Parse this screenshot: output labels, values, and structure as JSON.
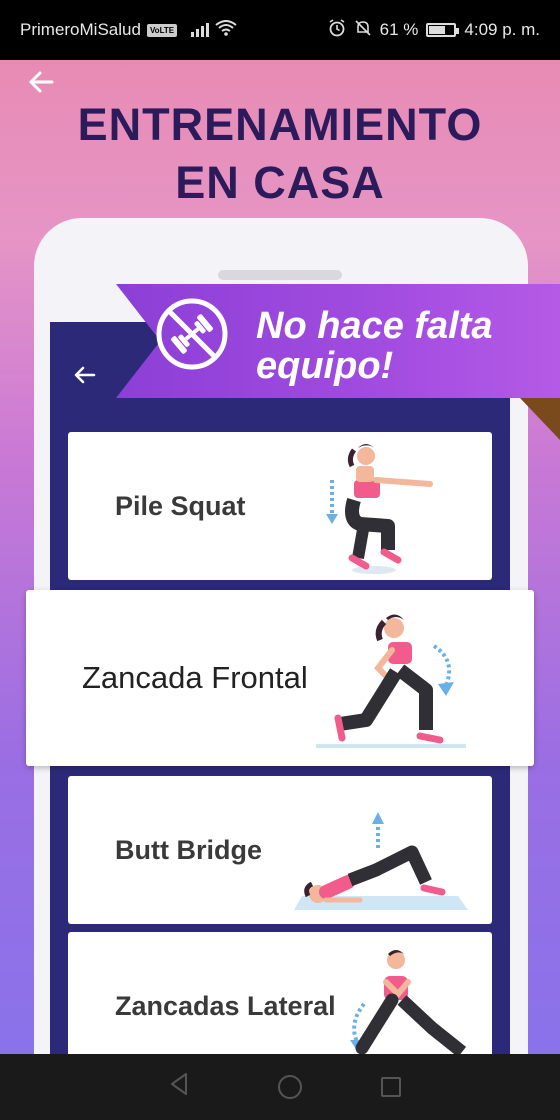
{
  "status_bar": {
    "carrier": "PrimeroMiSalud",
    "volte": "VoLTE",
    "battery": "61 %",
    "battery_level": 0.61,
    "time": "4:09 p. m."
  },
  "header": {
    "back_icon": "arrow-left-icon",
    "title_line1": "ENTRENAMIENTO",
    "title_line2": "EN CASA"
  },
  "banner": {
    "icon": "no-dumbbell-icon",
    "text_line1": "No hace falta",
    "text_line2": "equipo!"
  },
  "exercises": [
    {
      "label": "Pile Squat"
    },
    {
      "label": "Zancada Frontal"
    },
    {
      "label": "Butt Bridge"
    },
    {
      "label": "Zancadas Lateral"
    }
  ],
  "colors": {
    "title": "#2b1b5a",
    "banner": "#a24ce0",
    "phone_screen": "#2c2a78",
    "figure_top": "#f25c8c",
    "figure_pants": "#3b3b3b"
  },
  "nav": {
    "back": "triangle-back-icon",
    "home": "circle-home-icon",
    "recents": "square-recents-icon"
  }
}
